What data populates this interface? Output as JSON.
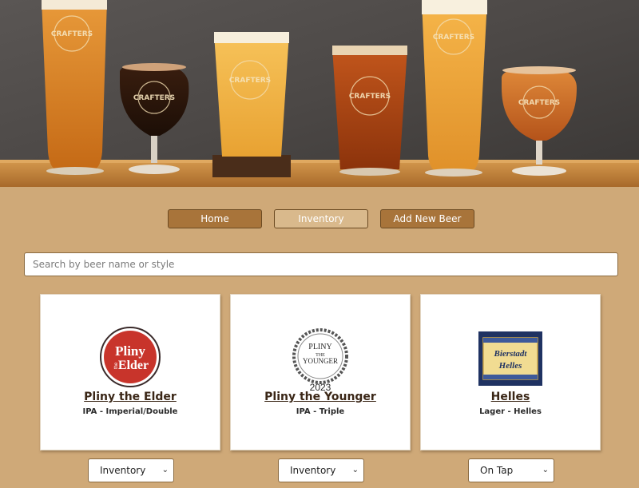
{
  "nav": {
    "home_label": "Home",
    "inventory_label": "Inventory",
    "add_label": "Add New Beer"
  },
  "hero": {
    "glass_logo_text": "CRAFTERS"
  },
  "search": {
    "placeholder": "Search by beer name or style",
    "value": ""
  },
  "beers": [
    {
      "name": "Pliny the Elder",
      "style": "IPA - Imperial/Double",
      "status": "Inventory",
      "logo_icon": "pliny-the-elder-logo",
      "logo_text_1": "Pliny",
      "logo_text_2": "the",
      "logo_text_3": "Elder"
    },
    {
      "name": "Pliny the Younger",
      "style": "IPA - Triple",
      "status": "Inventory",
      "logo_icon": "pliny-the-younger-logo",
      "logo_text_1": "PLINY",
      "logo_text_2": "THE",
      "logo_text_3": "YOUNGER",
      "logo_year": "2023"
    },
    {
      "name": "Helles",
      "style": "Lager - Helles",
      "status": "On Tap",
      "logo_icon": "bierstadt-helles-logo",
      "logo_text_1": "Bierstadt",
      "logo_text_2": "Helles"
    }
  ],
  "colors": {
    "background": "#cfa978",
    "button": "#a8743a",
    "button_active": "#d9b98c",
    "pliny_red": "#c8342b"
  }
}
